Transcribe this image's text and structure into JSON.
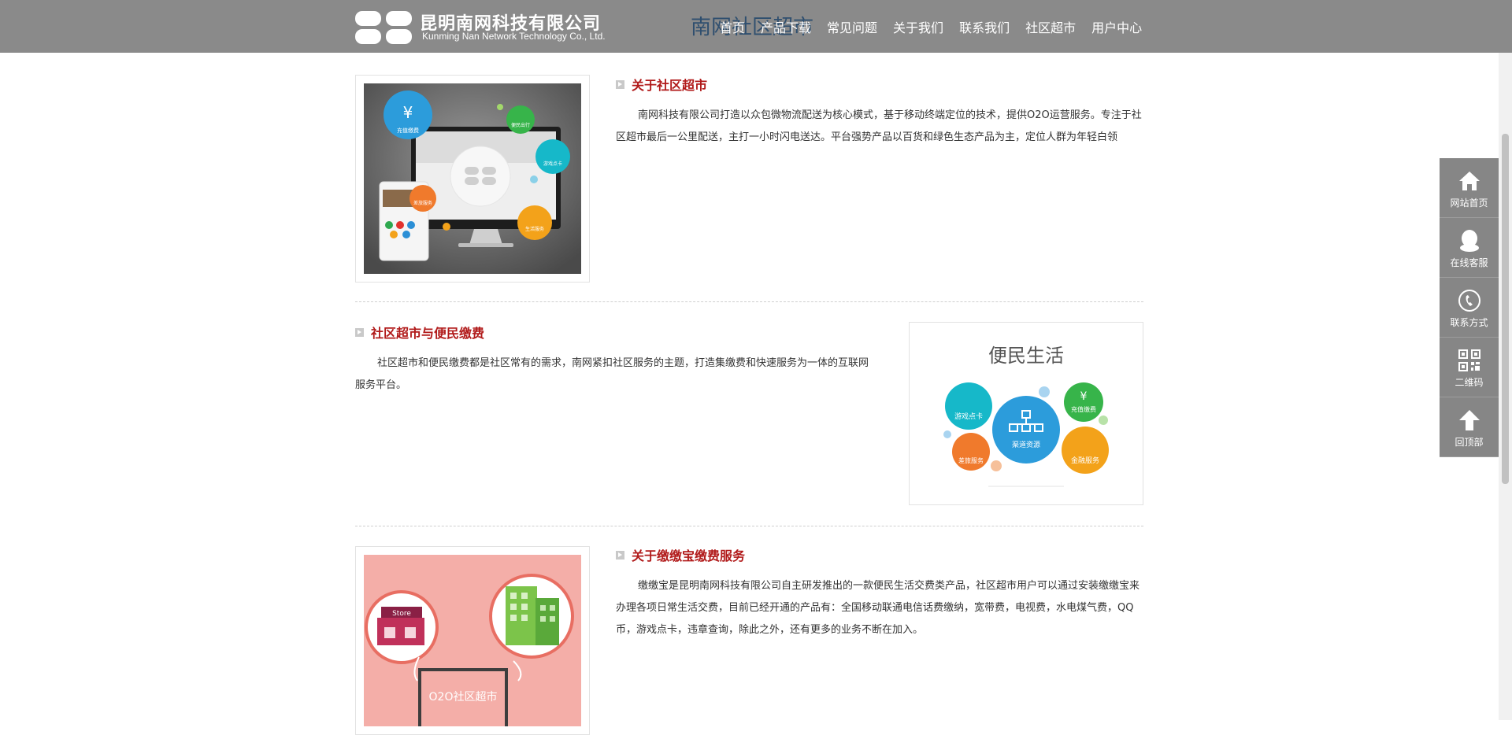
{
  "header": {
    "company_cn": "昆明南网科技有限公司",
    "company_en": "Kunming Nan Network Technology Co., Ltd.",
    "ghost_title": "南网社区超市",
    "nav": [
      "首页",
      "产品下载",
      "常见问题",
      "关于我们",
      "联系我们",
      "社区超市",
      "用户中心"
    ]
  },
  "sections": [
    {
      "title": "关于社区超市",
      "text": "南网科技有限公司打造以众包微物流配送为核心模式，基于移动终端定位的技术，提供O2O运营服务。专注于社区超市最后一公里配送，主打一小时闪电送达。平台强势产品以百货和绿色生态产品为主，定位人群为年轻白领",
      "image_labels": [
        "充值缴费",
        "便民出行",
        "游戏点卡",
        "差旅服务",
        "生活服务"
      ]
    },
    {
      "title": "社区超市与便民缴费",
      "text": "社区超市和便民缴费都是社区常有的需求，南网紧扣社区服务的主题，打造集缴费和快速服务为一体的互联网服务平台。",
      "image_title": "便民生活",
      "image_labels": [
        "游戏点卡",
        "渠道资源",
        "充值缴费",
        "差旅服务",
        "金融服务"
      ]
    },
    {
      "title": "关于缴缴宝缴费服务",
      "text": "缴缴宝是昆明南网科技有限公司自主研发推出的一款便民生活交费类产品，社区超市用户可以通过安装缴缴宝来办理各项日常生活交费，目前已经开通的产品有：全国移动联通电信话费缴纳，宽带费，电视费，水电煤气费，QQ币，游戏点卡，违章查询，除此之外，还有更多的业务不断在加入。",
      "image_labels": [
        "Store",
        "O2O社区超市"
      ]
    }
  ],
  "sidebar": [
    {
      "label": "网站首页",
      "icon": "home-icon"
    },
    {
      "label": "在线客服",
      "icon": "qq-icon"
    },
    {
      "label": "联系方式",
      "icon": "phone-icon"
    },
    {
      "label": "二维码",
      "icon": "qrcode-icon"
    },
    {
      "label": "回顶部",
      "icon": "arrow-up-icon"
    }
  ],
  "colors": {
    "header_bg": "#8a8a8a",
    "title_red": "#b11a1a",
    "sidebar_bg": "#868686"
  }
}
